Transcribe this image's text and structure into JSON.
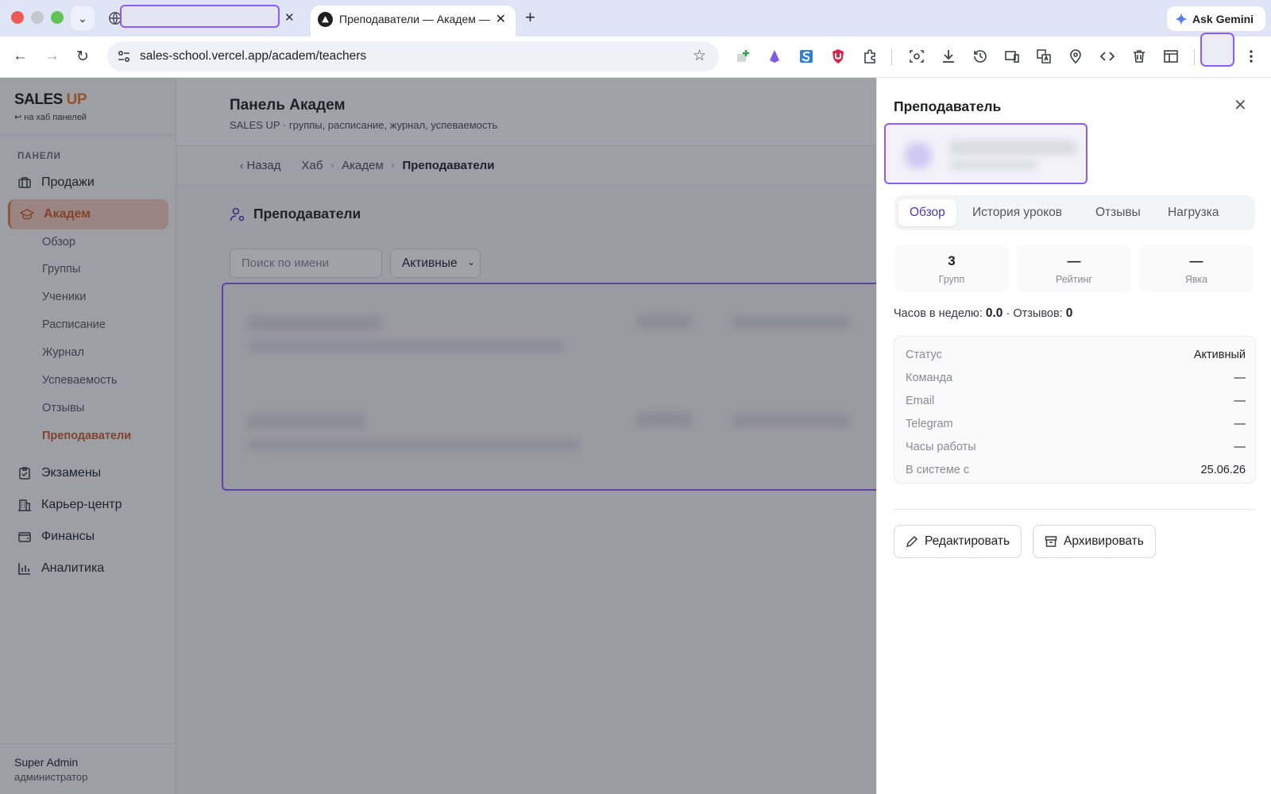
{
  "browser": {
    "active_tab_title": "Преподаватели — Академ —",
    "url": "sales-school.vercel.app/academ/teachers",
    "gemini_label": "Ask Gemini"
  },
  "sidebar": {
    "brand_main": "SALES",
    "brand_accent": "UP",
    "back_link": "↩ на хаб панелей",
    "section_label": "ПАНЕЛИ",
    "items": [
      {
        "label": "Продажи"
      },
      {
        "label": "Академ"
      },
      {
        "label": "Экзамены"
      },
      {
        "label": "Карьер-центр"
      },
      {
        "label": "Финансы"
      },
      {
        "label": "Аналитика"
      }
    ],
    "sub_items": [
      {
        "label": "Обзор"
      },
      {
        "label": "Группы"
      },
      {
        "label": "Ученики"
      },
      {
        "label": "Расписание"
      },
      {
        "label": "Журнал"
      },
      {
        "label": "Успеваемость"
      },
      {
        "label": "Отзывы"
      },
      {
        "label": "Преподаватели"
      }
    ],
    "user_name": "Super Admin",
    "user_role": "администратор"
  },
  "header": {
    "title": "Панель Академ",
    "subtitle": "SALES UP · группы, расписание, журнал, успеваемость"
  },
  "breadcrumbs": {
    "back": "Назад",
    "items": [
      "Хаб",
      "Академ",
      "Преподаватели"
    ]
  },
  "section": {
    "title": "Преподаватели",
    "search_placeholder": "Поиск по имени",
    "status_filter": "Активные"
  },
  "drawer": {
    "title": "Преподаватель",
    "tabs": [
      "Обзор",
      "История уроков",
      "Отзывы",
      "Нагрузка"
    ],
    "stats": [
      {
        "value": "3",
        "label": "Групп"
      },
      {
        "value": "—",
        "label": "Рейтинг"
      },
      {
        "value": "—",
        "label": "Явка"
      }
    ],
    "summary": {
      "hours_label": "Часов в неделю:",
      "hours_value": "0.0",
      "separator": "·",
      "reviews_label": "Отзывов:",
      "reviews_value": "0"
    },
    "info": [
      {
        "key": "Статус",
        "value": "Активный"
      },
      {
        "key": "Команда",
        "value": "—"
      },
      {
        "key": "Email",
        "value": "—"
      },
      {
        "key": "Telegram",
        "value": "—"
      },
      {
        "key": "Часы работы",
        "value": "—"
      },
      {
        "key": "В системе с",
        "value": "25.06.26"
      }
    ],
    "edit_label": "Редактировать",
    "archive_label": "Архивировать"
  },
  "colors": {
    "brand_accent": "#e67a2b",
    "active_nav_bg": "#f4cdbd",
    "active_tab_text": "#4a3bb0",
    "redaction_border": "#8b5cf6"
  }
}
